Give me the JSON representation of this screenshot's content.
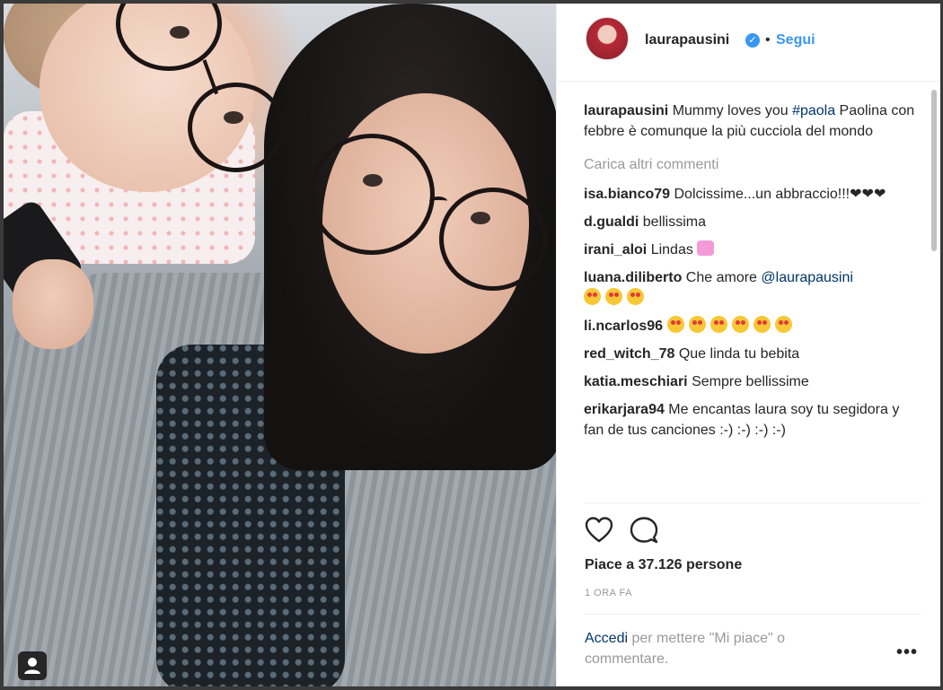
{
  "post": {
    "username": "laurapausini",
    "verified_icon": "verified-badge-icon",
    "separator": "•",
    "follow_label": "Segui",
    "caption_user": "laurapausini",
    "caption_text": " Mummy loves you ",
    "caption_hashtag": "#paola",
    "caption_text2": " Paolina con febbre è comunque la più cucciola del mondo",
    "load_more": "Carica altri commenti",
    "comments": [
      {
        "user": "isa.bianco79",
        "text": " Dolcissime...un abbraccio!!!❤❤❤"
      },
      {
        "user": "d.gualdi",
        "text": " bellissima"
      },
      {
        "user": "irani_aloi",
        "text": " Lindas"
      },
      {
        "user": "luana.diliberto",
        "text": " Che amore ",
        "mention": "@laurapausini"
      },
      {
        "user": "li.ncarlos96",
        "text": " "
      },
      {
        "user": "red_witch_78",
        "text": " Que linda tu bebita"
      },
      {
        "user": "katia.meschiari",
        "text": " Sempre bellissime"
      },
      {
        "user": "erikarjara94",
        "text": " Me encantas laura soy tu segidora y fan de tus canciones :-) :-) :-) :-)"
      }
    ],
    "likes": "Piace a 37.126 persone",
    "time": "1 ORA FA",
    "login_link": "Accedi",
    "login_text": " per mettere \"Mi piace\" o commentare.",
    "more_icon": "•••",
    "icons": [
      "heart-icon",
      "comment-icon",
      "user-tag-icon",
      "more-options-icon"
    ],
    "colors": {
      "link": "#3897f0",
      "hashtag": "#003569",
      "muted": "#999999"
    }
  }
}
